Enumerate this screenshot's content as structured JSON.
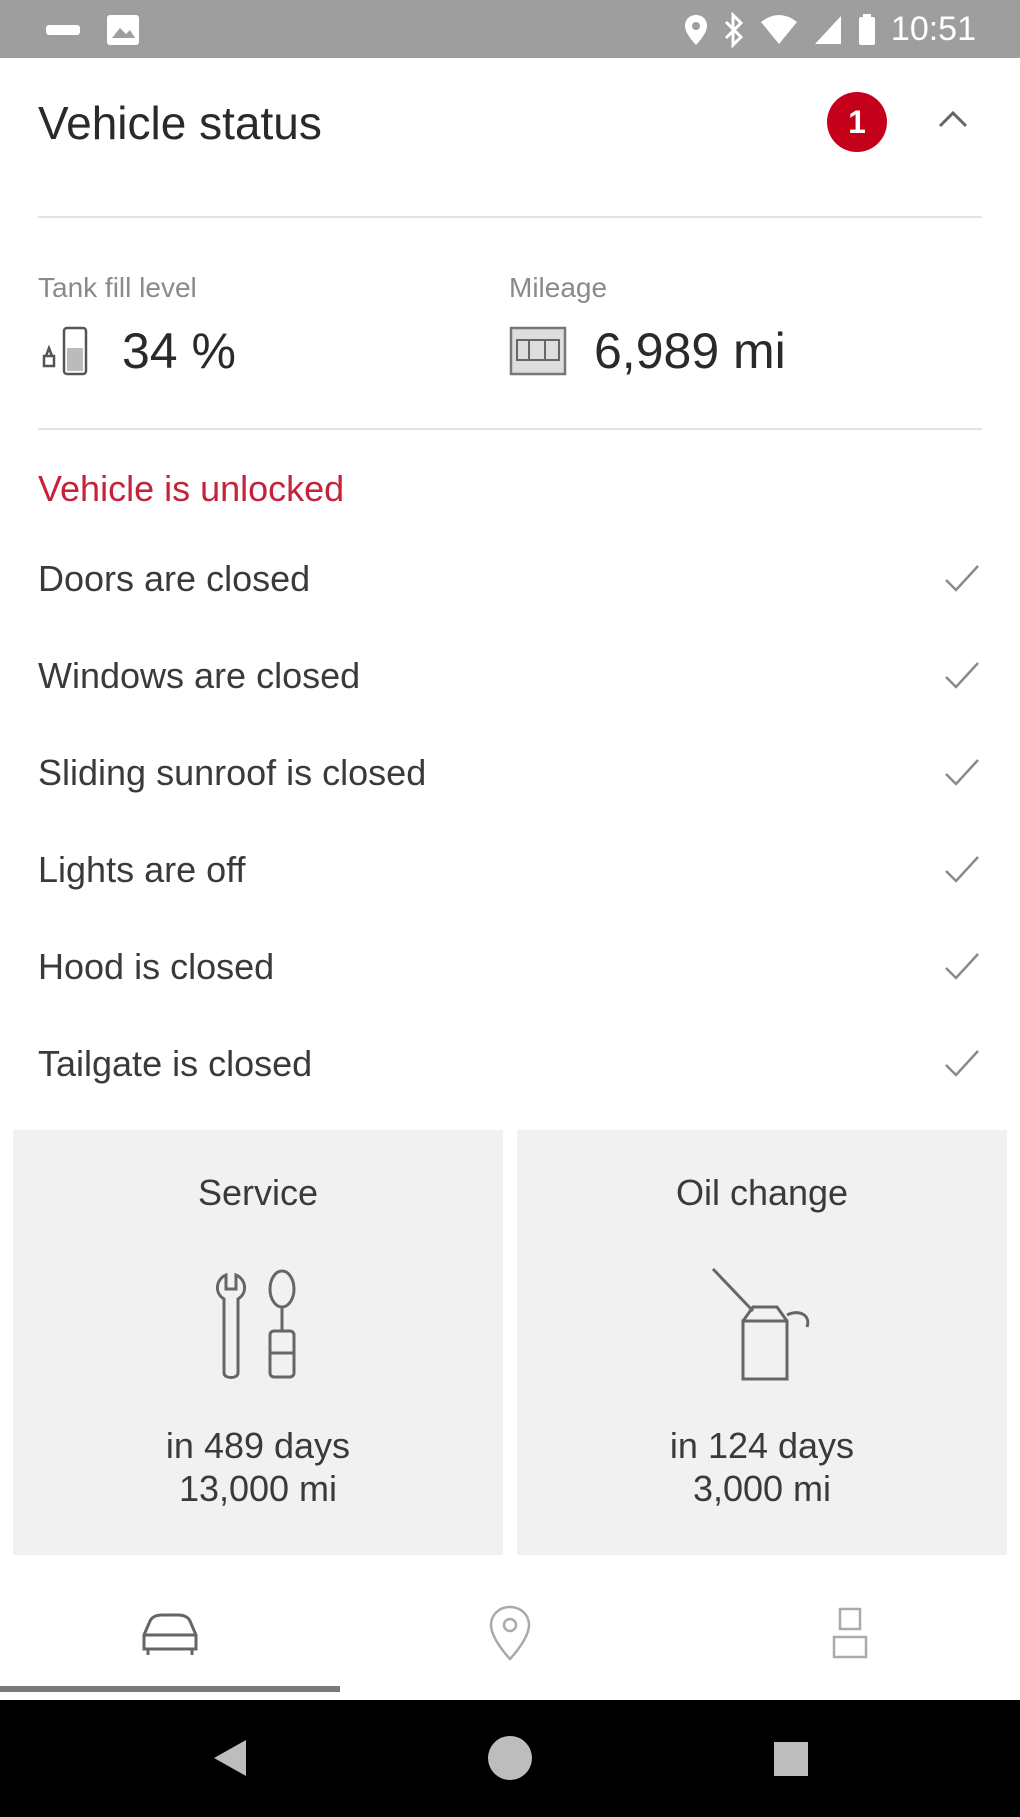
{
  "status_bar": {
    "time": "10:51"
  },
  "header": {
    "title": "Vehicle status",
    "badge_count": "1"
  },
  "metrics": {
    "tank": {
      "label": "Tank fill level",
      "value": "34 %"
    },
    "mileage": {
      "label": "Mileage",
      "value": "6,989 mi"
    }
  },
  "lock_status": "Vehicle is unlocked",
  "status_items": [
    "Doors are closed",
    "Windows are closed",
    "Sliding sunroof is closed",
    "Lights are off",
    "Hood is closed",
    "Tailgate is closed"
  ],
  "cards": {
    "service": {
      "title": "Service",
      "days": "in 489 days",
      "distance": "13,000 mi"
    },
    "oil": {
      "title": "Oil change",
      "days": "in 124 days",
      "distance": "3,000 mi"
    }
  },
  "colors": {
    "accent": "#c4001a",
    "warning_text": "#c4233a",
    "card_bg": "#f1f1f1"
  },
  "icons": {
    "nav": [
      "car-icon",
      "location-pin-icon",
      "user-icon"
    ],
    "system": [
      "back-icon",
      "home-icon",
      "recents-icon"
    ]
  }
}
